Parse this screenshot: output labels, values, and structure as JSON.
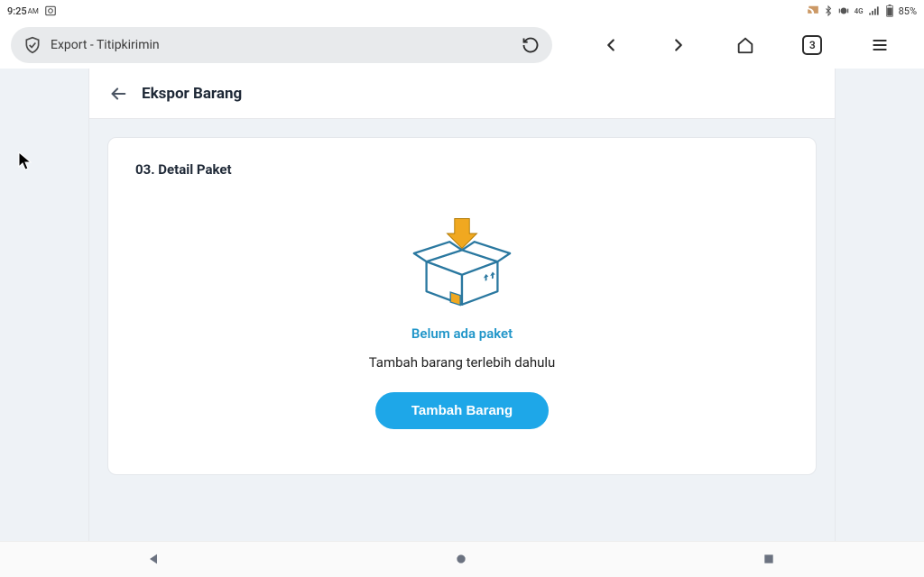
{
  "status": {
    "time": "9:25",
    "ampm": "AM",
    "battery": "85%"
  },
  "browser": {
    "url_label": "Export - Titipkirimin",
    "tab_count": "3"
  },
  "page": {
    "title": "Ekspor Barang"
  },
  "card": {
    "title": "03. Detail Paket",
    "empty_heading": "Belum ada paket",
    "empty_sub": "Tambah barang terlebih dahulu",
    "button": "Tambah Barang"
  }
}
